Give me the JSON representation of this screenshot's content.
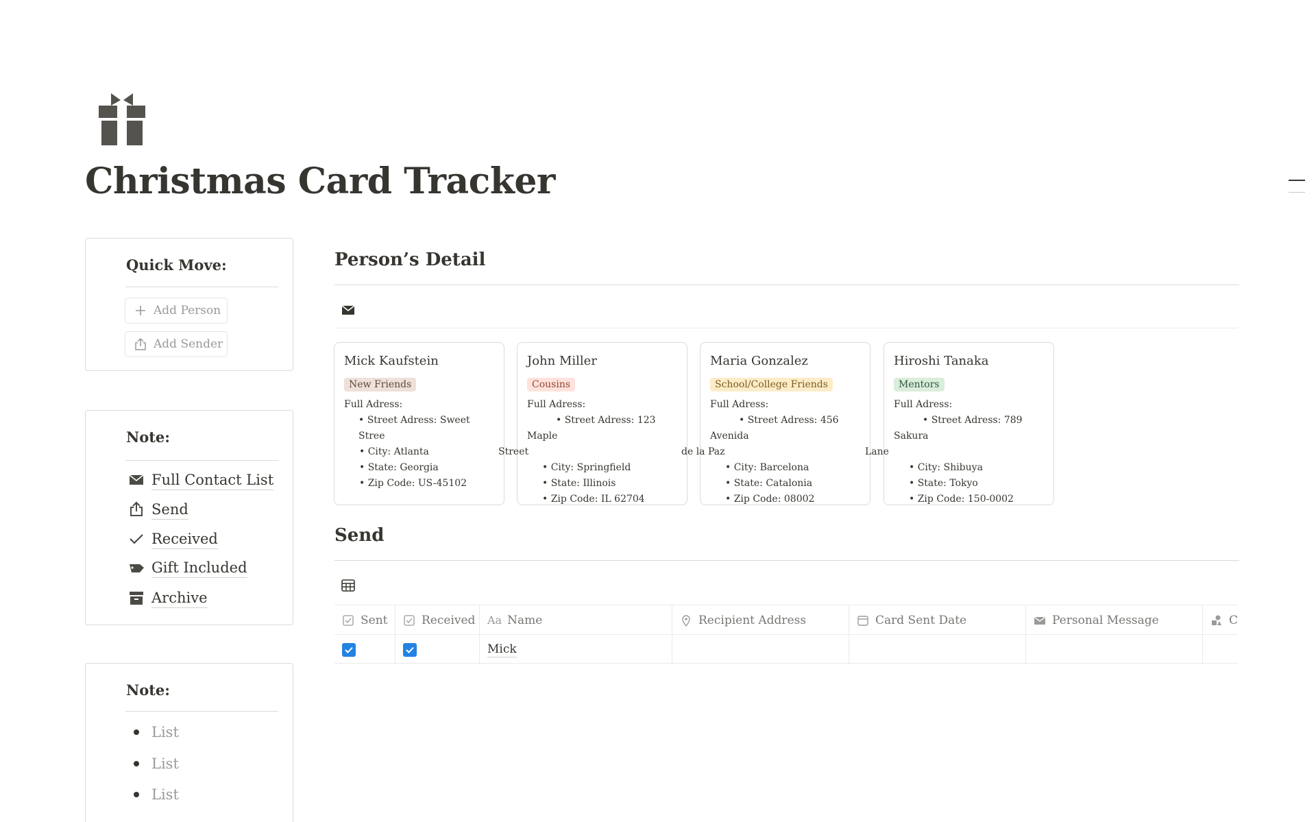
{
  "page": {
    "icon": "gift-icon",
    "title": "Christmas Card Tracker"
  },
  "quick_move": {
    "heading": "Quick Move:",
    "buttons": [
      {
        "label": "Add Person",
        "icon": "plus-icon"
      },
      {
        "label": "Add Sender",
        "icon": "share-icon"
      }
    ]
  },
  "note_nav": {
    "heading": "Note:",
    "items": [
      {
        "label": "Full Contact List",
        "icon": "envelope-icon"
      },
      {
        "label": "Send",
        "icon": "upload-icon"
      },
      {
        "label": "Received",
        "icon": "checkmark-icon"
      },
      {
        "label": "Gift Included",
        "icon": "tag-icon"
      },
      {
        "label": "Archive",
        "icon": "archive-icon"
      }
    ]
  },
  "note_list": {
    "heading": "Note:",
    "items": [
      "List",
      "List",
      "List"
    ]
  },
  "persons": {
    "title": "Person’s Detail",
    "view_icon": "envelope-icon",
    "cards": [
      {
        "name": "Mick Kaufstein",
        "tag": "New Friends",
        "tag_bg": "#eee0da",
        "tag_fg": "#64473a",
        "address_label": "Full Adress:",
        "street": "• Street Adress: Sweet Stree",
        "street_cont": "",
        "city": "• City: Atlanta",
        "state": "• State: Georgia",
        "zip": "• Zip Code: US-45102"
      },
      {
        "name": "John Miller",
        "tag": "Cousins",
        "tag_bg": "#ffe2dd",
        "tag_fg": "#93452f",
        "address_label": "Full Adress:",
        "street": "• Street Adress: 123 Maple",
        "street_cont": "Street",
        "city": "• City: Springfield",
        "state": "• State: Illinois",
        "zip": "• Zip Code: IL 62704"
      },
      {
        "name": "Maria Gonzalez",
        "tag": "School/College Friends",
        "tag_bg": "#fdecc8",
        "tag_fg": "#7a5c1e",
        "address_label": "Full Adress:",
        "street": "• Street Adress: 456 Avenida",
        "street_cont": "de la Paz",
        "city": "• City: Barcelona",
        "state": "• State: Catalonia",
        "zip": "• Zip Code: 08002"
      },
      {
        "name": "Hiroshi Tanaka",
        "tag": "Mentors",
        "tag_bg": "#dbeddb",
        "tag_fg": "#2b593f",
        "address_label": "Full Adress:",
        "street": "• Street Adress: 789 Sakura",
        "street_cont": "Lane",
        "city": "• City: Shibuya",
        "state": "• State: Tokyo",
        "zip": "• Zip Code: 150-0002"
      }
    ]
  },
  "send": {
    "title": "Send",
    "view_icon": "table-icon",
    "columns": [
      {
        "label": "Sent",
        "icon": "checkbox-icon"
      },
      {
        "label": "Received",
        "icon": "checkbox-icon"
      },
      {
        "label": "Name",
        "icon": "text-icon",
        "prefix": "Aa"
      },
      {
        "label": "Recipient Address",
        "icon": "location-pin-icon"
      },
      {
        "label": "Card Sent Date",
        "icon": "calendar-icon"
      },
      {
        "label": "Personal Message",
        "icon": "envelope-icon"
      },
      {
        "label": "Ca",
        "icon": "shapes-icon"
      }
    ],
    "rows": [
      {
        "sent": true,
        "received": true,
        "name": "Mick",
        "recipient_address": "",
        "card_sent_date": "",
        "personal_message": ""
      }
    ]
  },
  "colors": {
    "text": "#37352f",
    "muted": "#9b9a97",
    "checkbox_accent": "#2383e2",
    "border": "#dcdad6"
  }
}
